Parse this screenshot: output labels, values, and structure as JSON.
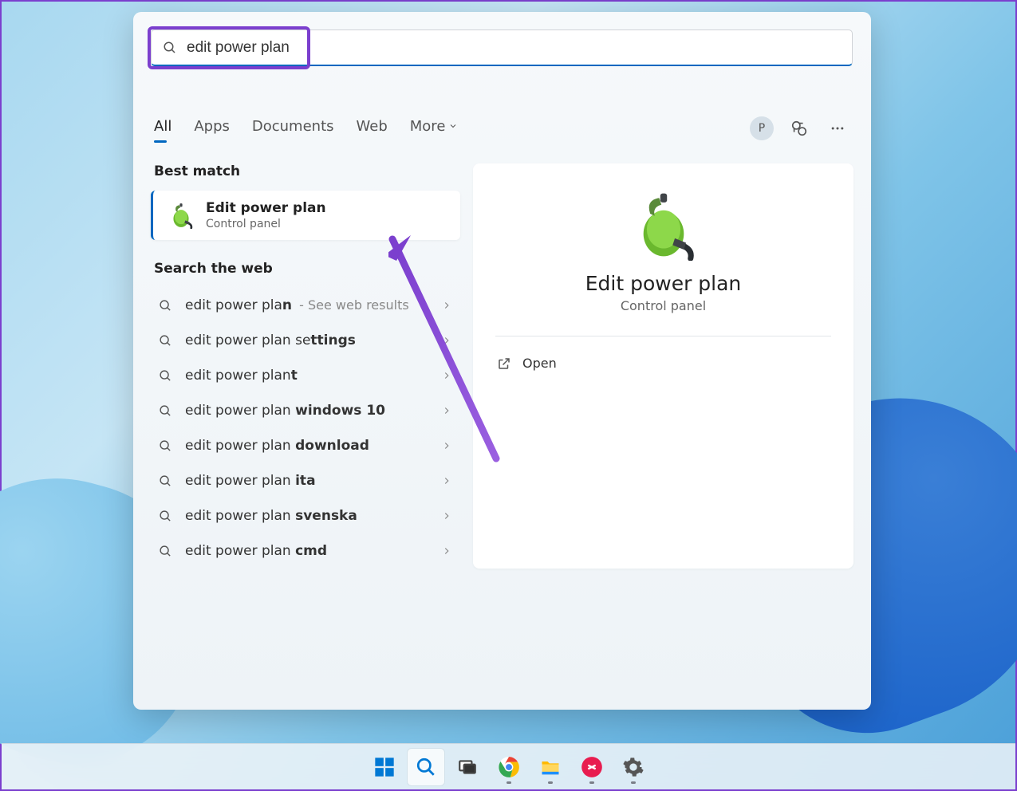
{
  "search": {
    "query": "edit power plan"
  },
  "tabs": {
    "all": "All",
    "apps": "Apps",
    "documents": "Documents",
    "web": "Web",
    "more": "More"
  },
  "user": {
    "initial": "P"
  },
  "left": {
    "best_match_label": "Best match",
    "best_match": {
      "title": "Edit power plan",
      "subtitle": "Control panel"
    },
    "search_web_label": "Search the web",
    "web_results": [
      {
        "prefix": "edit power pla",
        "bold": "n",
        "hint": " - See web results"
      },
      {
        "prefix": "edit power plan se",
        "bold": "ttings",
        "hint": ""
      },
      {
        "prefix": "edit power plan",
        "bold": "t",
        "hint": ""
      },
      {
        "prefix": "edit power plan ",
        "bold": "windows 10",
        "hint": ""
      },
      {
        "prefix": "edit power plan ",
        "bold": "download",
        "hint": ""
      },
      {
        "prefix": "edit power plan ",
        "bold": "ita",
        "hint": ""
      },
      {
        "prefix": "edit power plan ",
        "bold": "svenska",
        "hint": ""
      },
      {
        "prefix": "edit power plan ",
        "bold": "cmd",
        "hint": ""
      }
    ]
  },
  "detail": {
    "title": "Edit power plan",
    "subtitle": "Control panel",
    "open_label": "Open"
  },
  "colors": {
    "accent": "#0067c0",
    "highlight": "#7b3fce"
  }
}
